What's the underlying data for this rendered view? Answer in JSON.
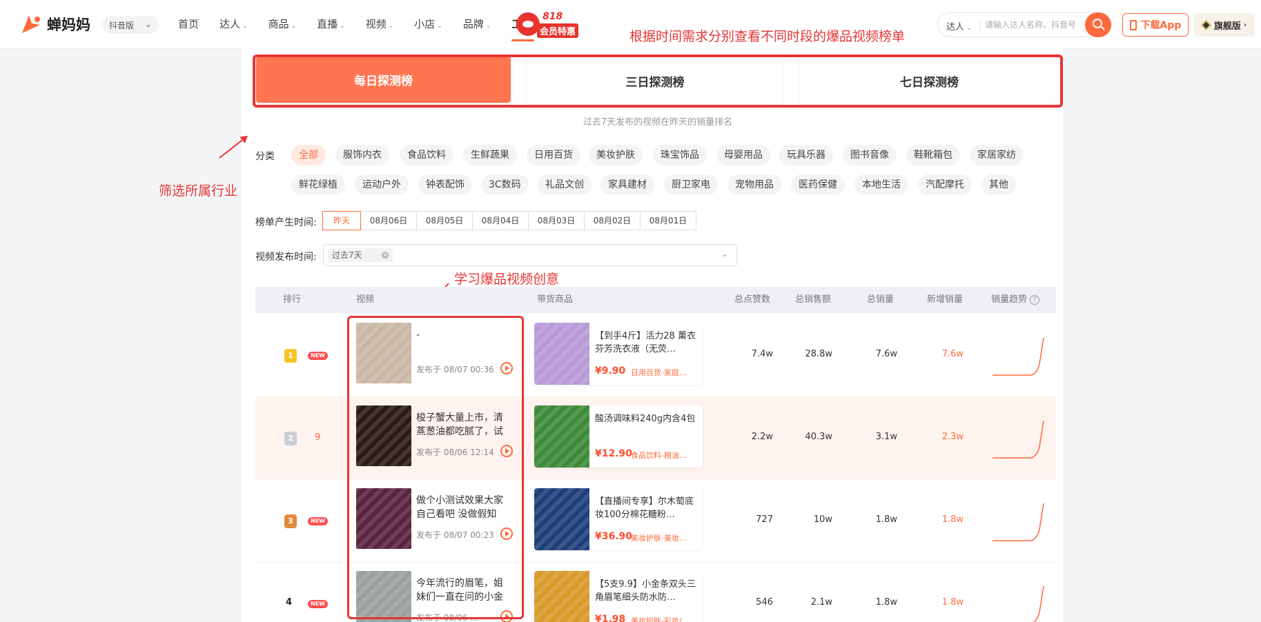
{
  "brand": {
    "name": "蝉妈妈",
    "color": "#ff6a3c"
  },
  "platform": {
    "selected": "抖音版"
  },
  "nav": {
    "items": [
      {
        "label": "首页",
        "dropdown": false
      },
      {
        "label": "达人",
        "dropdown": true
      },
      {
        "label": "商品",
        "dropdown": true
      },
      {
        "label": "直播",
        "dropdown": true
      },
      {
        "label": "视频",
        "dropdown": true
      },
      {
        "label": "小店",
        "dropdown": true
      },
      {
        "label": "品牌",
        "dropdown": true
      },
      {
        "label": "工具",
        "dropdown": true,
        "active": true
      }
    ],
    "promo_number": "818",
    "promo_text": "会员特惠"
  },
  "search": {
    "type": "达人",
    "placeholder": "请输入达人名称、抖音号"
  },
  "header_buttons": {
    "download": "下载App",
    "flagship": "旗舰版"
  },
  "annotations": {
    "top": "根据时间需求分别查看不同时段的爆品视频榜单",
    "left": "筛选所属行业",
    "mid": "学习爆品视频创意"
  },
  "tabs": [
    {
      "label": "每日探测榜",
      "active": true
    },
    {
      "label": "三日探测榜",
      "active": false
    },
    {
      "label": "七日探测榜",
      "active": false
    }
  ],
  "tab_subtitle": "过去7天发布的视频在昨天的销量排名",
  "category": {
    "label": "分类",
    "row1": [
      "全部",
      "服饰内衣",
      "食品饮料",
      "生鲜蔬果",
      "日用百货",
      "美妆护肤",
      "珠宝饰品",
      "母婴用品",
      "玩具乐器",
      "图书音像",
      "鞋靴箱包",
      "家居家纺"
    ],
    "row2": [
      "鲜花绿植",
      "运动户外",
      "钟表配饰",
      "3C数码",
      "礼品文创",
      "家具建材",
      "厨卫家电",
      "宠物用品",
      "医药保健",
      "本地生活",
      "汽配摩托",
      "其他"
    ]
  },
  "rank_time": {
    "label": "榜单产生时间:",
    "options": [
      "昨天",
      "08月06日",
      "08月05日",
      "08月04日",
      "08月03日",
      "08月02日",
      "08月01日"
    ]
  },
  "publish_time": {
    "label": "视频发布时间:",
    "tag": "过去7天"
  },
  "table": {
    "headers": {
      "rank": "排行",
      "video": "视频",
      "product": "带货商品",
      "likes": "总点赞数",
      "sales_amount": "总销售额",
      "sales": "总销量",
      "new_sales": "新增销量",
      "trend": "销量趋势"
    },
    "rows": [
      {
        "rank": "1",
        "badge": "gold",
        "new": "NEW",
        "change": "",
        "video_title": "-",
        "video_date": "发布于 08/07 00:36",
        "product_title": "【到手4斤】活力28 薰衣芬芳洗衣液（无荧…",
        "price": "¥9.90",
        "category": "日用百货-家庭…",
        "likes": "7.4w",
        "sales_amount": "28.8w",
        "sales": "7.6w",
        "new_sales": "7.6w",
        "thumb_color": "#c9b8a6",
        "product_color": "#b89ad8"
      },
      {
        "rank": "2",
        "badge": "silver",
        "new": "",
        "change": "9",
        "video_title": "梭子蟹大量上市，清蒸葱油都吃腻了，试试…",
        "video_date": "发布于 08/06 12:14",
        "product_title": "酸汤调味料240g内含4包",
        "price": "¥12.90",
        "category": "食品饮料-粮油…",
        "likes": "2.2w",
        "sales_amount": "40.3w",
        "sales": "3.1w",
        "new_sales": "2.3w",
        "thumb_color": "#2a1c14",
        "product_color": "#3f8a3a"
      },
      {
        "rank": "3",
        "badge": "bronze",
        "new": "NEW",
        "change": "",
        "video_title": "做个小测试效果大家自己看吧 没做假知道…",
        "video_date": "发布于 08/07 00:23",
        "product_title": "【直播间专享】尔木萄底妆100分棉花糖粉…",
        "price": "¥36.90",
        "category": "美妆护肤-美妆…",
        "likes": "727",
        "sales_amount": "10w",
        "sales": "1.8w",
        "new_sales": "1.8w",
        "thumb_color": "#5a2440",
        "product_color": "#1f3f7a"
      },
      {
        "rank": "4",
        "badge": "",
        "new": "NEW",
        "change": "",
        "video_title": "今年流行的眉笔，姐妹们一直在问的小金条…",
        "video_date": "发布于 08/06 …",
        "product_title": "【5支9.9】小金条双头三角眉笔细头防水防…",
        "price": "¥1.98",
        "category": "美妆护肤-彩妆/…",
        "likes": "546",
        "sales_amount": "2.1w",
        "sales": "1.8w",
        "new_sales": "1.8w",
        "thumb_color": "#9aa0a0",
        "product_color": "#d99a2b"
      }
    ]
  }
}
